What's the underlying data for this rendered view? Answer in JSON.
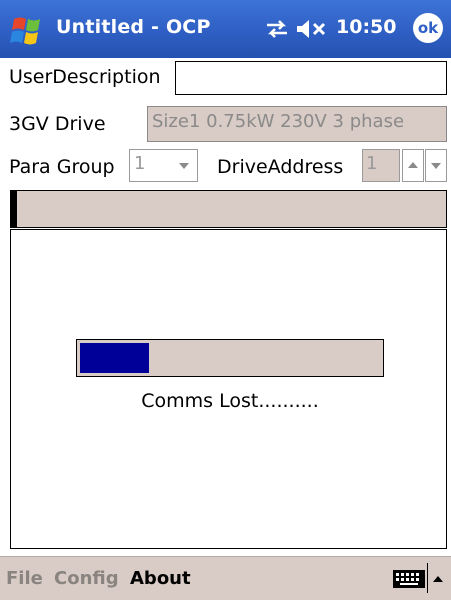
{
  "titlebar": {
    "title": "Untitled - OCP",
    "time": "10:50",
    "ok_label": "ok",
    "icons": [
      "windows-start-icon",
      "connectivity-icon",
      "volume-muted-icon"
    ]
  },
  "form": {
    "user_description": {
      "label": "UserDescription",
      "value": ""
    },
    "drive": {
      "label": "3GV Drive",
      "value": "Size1 0.75kW 230V 3 phase"
    },
    "para_group": {
      "label": "Para Group",
      "value": "1"
    },
    "drive_address": {
      "label": "DriveAddress",
      "value": "1"
    }
  },
  "progress": {
    "fraction": 0.23,
    "status": "Comms Lost.........."
  },
  "menubar": {
    "items": [
      {
        "label": "File",
        "enabled": false
      },
      {
        "label": "Config",
        "enabled": false
      },
      {
        "label": "About",
        "enabled": true
      }
    ],
    "icons": [
      "keyboard-icon",
      "sip-arrow-up-icon"
    ]
  },
  "colors": {
    "titlebar_blue": "#2f5fc4",
    "panel_beige": "#d9cbc5",
    "progress_fill": "#000099",
    "disabled_text": "#8a8a8a"
  }
}
